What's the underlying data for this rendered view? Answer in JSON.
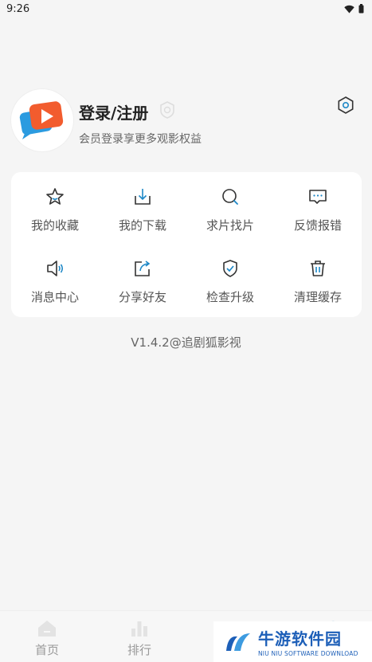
{
  "status_bar": {
    "time": "9:26"
  },
  "profile": {
    "title": "登录/注册",
    "subtitle": "会员登录享更多观影权益"
  },
  "menu": {
    "items": [
      {
        "label": "我的收藏",
        "icon": "star-icon"
      },
      {
        "label": "我的下载",
        "icon": "download-icon"
      },
      {
        "label": "求片找片",
        "icon": "search-icon"
      },
      {
        "label": "反馈报错",
        "icon": "feedback-icon"
      },
      {
        "label": "消息中心",
        "icon": "speaker-icon"
      },
      {
        "label": "分享好友",
        "icon": "share-icon"
      },
      {
        "label": "检查升级",
        "icon": "shield-check-icon"
      },
      {
        "label": "清理缓存",
        "icon": "trash-icon"
      }
    ]
  },
  "version": "V1.4.2@追剧狐影视",
  "tabbar": {
    "tabs": [
      {
        "label": "首页",
        "icon": "home-icon"
      },
      {
        "label": "排行",
        "icon": "ranking-icon"
      }
    ]
  },
  "watermark": {
    "main": "牛游软件园",
    "sub": "NIU NIU SOFTWARE DOWNLOAD"
  },
  "colors": {
    "accent": "#1e88c7",
    "background": "#f5f5f5",
    "card": "#ffffff",
    "watermark": "#1d5fb8"
  }
}
